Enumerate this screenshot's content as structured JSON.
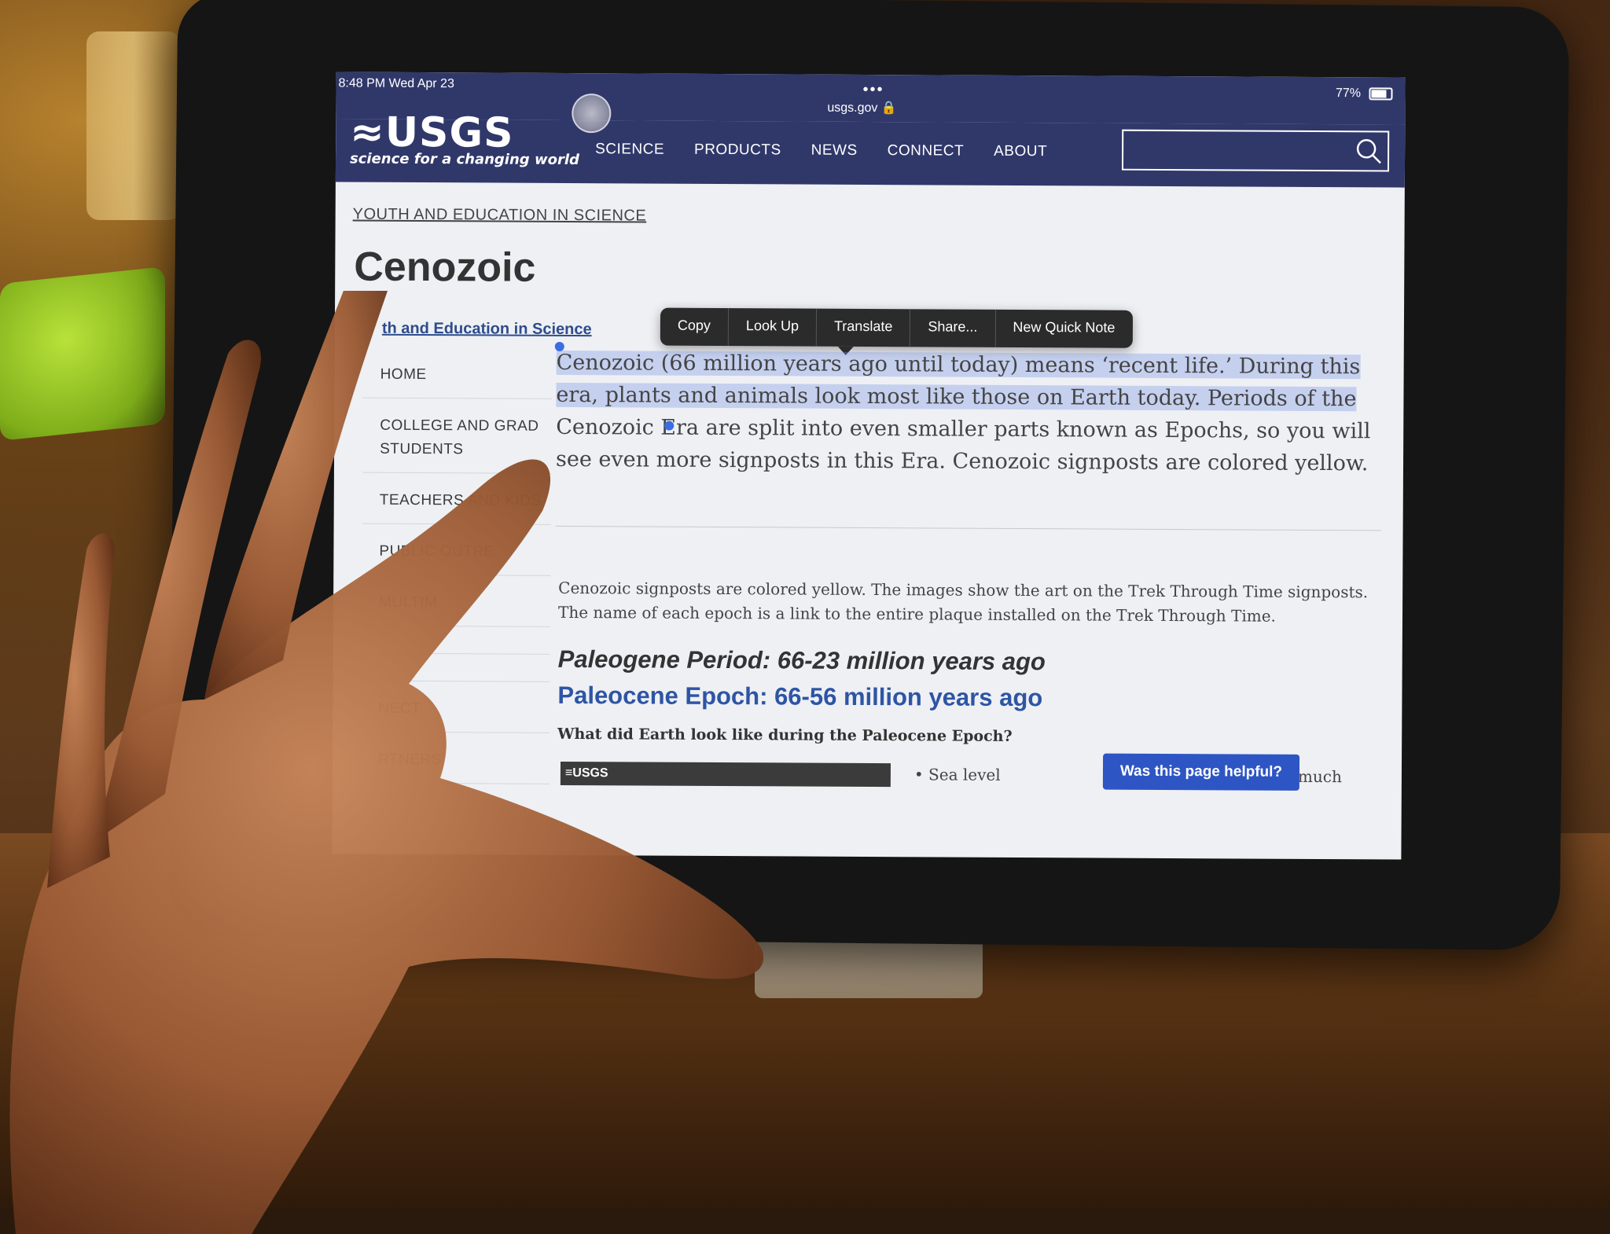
{
  "status": {
    "time_date": "8:48 PM   Wed Apr 23",
    "url": "usgs.gov 🔒",
    "dots": "•••",
    "battery": "77%"
  },
  "header": {
    "logo_word": "≈USGS",
    "logo_tagline": "science for a changing world",
    "nav": [
      "SCIENCE",
      "PRODUCTS",
      "NEWS",
      "CONNECT",
      "ABOUT"
    ],
    "search_placeholder": ""
  },
  "breadcrumb": "YOUTH AND EDUCATION IN SCIENCE",
  "page_title": "Cenozoic",
  "section_link": "th and Education in Science",
  "sidebar": {
    "items": [
      "HOME",
      "COLLEGE AND GRAD STUDENTS",
      "TEACHERS AND KIDS",
      "PUBLIC OUTRE",
      "MULTIM",
      "",
      "",
      "NECT",
      "RTNERS"
    ]
  },
  "context_menu": [
    "Copy",
    "Look Up",
    "Translate",
    "Share...",
    "New Quick Note"
  ],
  "intro": {
    "selected": "Cenozoic (66 million years ago until today) means ‘recent life.’ During this era, plants and animals look most like those on Earth today. Periods of the",
    "rest": " Cenozoic Era are split into even smaller parts known as Epochs, so you will see even more signposts in this Era. Cenozoic signposts are colored yellow."
  },
  "desc": "Cenozoic signposts are colored yellow. The images show the art on the Trek Through Time signposts. The name of each epoch is a link to the entire plaque installed on the Trek Through Time.",
  "period_title": "Paleogene Period: 66-23 million years ago",
  "epoch_link": "Paleocene Epoch: 66-56 million years ago",
  "epoch_question": "What did Earth look like during the Paleocene Epoch?",
  "plaque_label": "≡USGS",
  "bullet_start": "•  Sea level",
  "bullet_end": "much",
  "helpful_button": "Was this page helpful?",
  "colors": {
    "header": "#30386a",
    "link": "#2e55a4",
    "selection": "#7896e6",
    "button": "#2e55c4"
  }
}
